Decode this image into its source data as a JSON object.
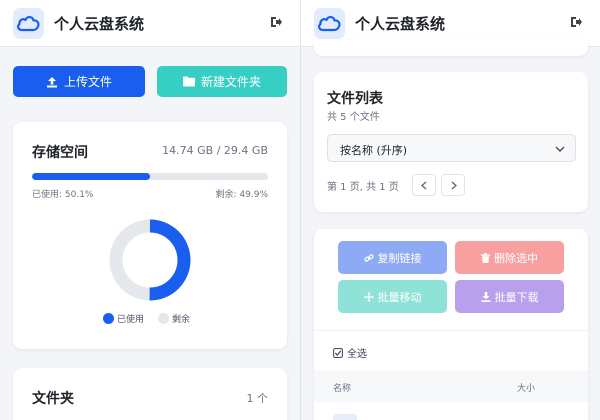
{
  "app": {
    "title": "个人云盘系统"
  },
  "left": {
    "upload_label": "上传文件",
    "new_folder_label": "新建文件夹",
    "storage": {
      "title": "存储空间",
      "usage_text": "14.74 GB / 29.4 GB",
      "used_text": "已使用: 50.1%",
      "remaining_text": "剩余: 49.9%",
      "used_fraction": 0.501,
      "legend_used": "已使用",
      "legend_remaining": "剩余"
    },
    "folders": {
      "title": "文件夹",
      "count": "1 个"
    }
  },
  "right": {
    "file_list": {
      "title": "文件列表",
      "subtitle": "共 5 个文件",
      "sort_selected": "按名称 (升序)",
      "pagination_text": "第 1 页, 共 1 页"
    },
    "actions": {
      "copy_link": "复制链接",
      "delete_selected": "删除选中",
      "batch_move": "批量移动",
      "batch_download": "批量下载"
    },
    "select_all": "全选",
    "columns": {
      "name": "名称",
      "size": "大小"
    }
  },
  "colors": {
    "primary": "#1a5ef0",
    "teal": "#37cfc4",
    "used": "#1a5ef0",
    "remaining": "#e4e7ec",
    "copy_link": "#8faaf5",
    "delete": "#f8a0a0",
    "batch_move": "#8fe2d8",
    "batch_download": "#b9a0ec"
  }
}
